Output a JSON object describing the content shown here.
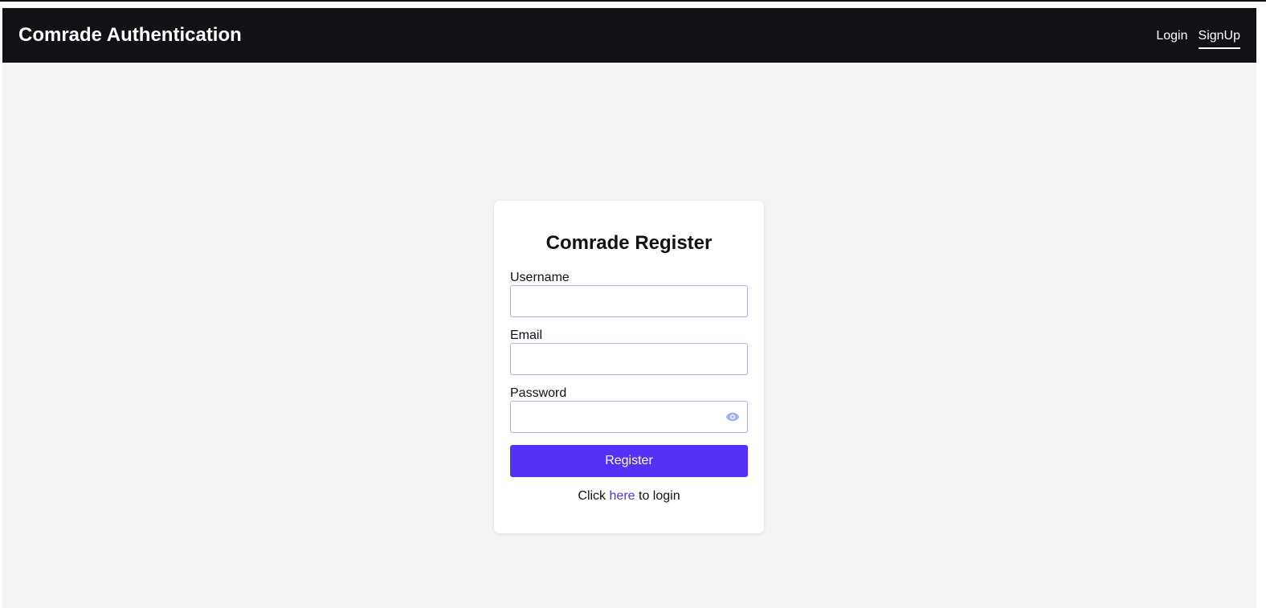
{
  "header": {
    "brand": "Comrade Authentication",
    "nav": [
      {
        "label": "Login",
        "active": false
      },
      {
        "label": "SignUp",
        "active": true
      }
    ]
  },
  "form": {
    "title": "Comrade Register",
    "username": {
      "label": "Username",
      "value": "",
      "placeholder": ""
    },
    "email": {
      "label": "Email",
      "value": "",
      "placeholder": ""
    },
    "password": {
      "label": "Password",
      "value": "",
      "placeholder": ""
    },
    "password_toggle_icon": "eye-icon",
    "submit_label": "Register",
    "footer": {
      "prefix": "Click",
      "link_label": "here",
      "suffix": "to login"
    }
  },
  "colors": {
    "navbar": "#111116",
    "background": "#f4f4f4",
    "accent": "#5531f8",
    "input_border": "#a8b3f0"
  }
}
